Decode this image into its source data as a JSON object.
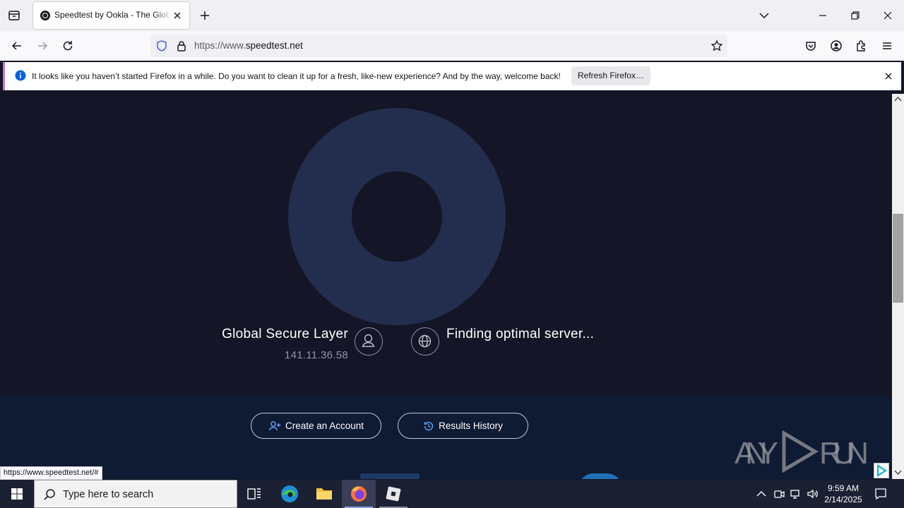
{
  "browser": {
    "tab_title": "Speedtest by Ookla - The Global Broadband Speed Test",
    "url_prefix": "https://www.",
    "url_domain": "speedtest.net",
    "link_preview": "https://www.speedtest.net/#"
  },
  "notification": {
    "message": "It looks like you haven’t started Firefox in a while. Do you want to clean it up for a fresh, like-new experience? And by the way, welcome back!",
    "button_label": "Refresh Firefox…"
  },
  "speedtest": {
    "isp_name": "Global Secure Layer",
    "ip_address": "141.11.36.58",
    "server_status": "Finding optimal server...",
    "create_account_label": "Create an Account",
    "results_history_label": "Results History"
  },
  "taskbar": {
    "search_placeholder": "Type here to search",
    "time": "9:59 AM",
    "date": "2/14/2025"
  },
  "watermark": "ANY RUN",
  "colors": {
    "page_bg": "#141526",
    "gauge_ring": "#232d4d",
    "lower_band": "#0f1a33",
    "accent_blue": "#5aa9ff",
    "taskbar": "#1c2033"
  }
}
